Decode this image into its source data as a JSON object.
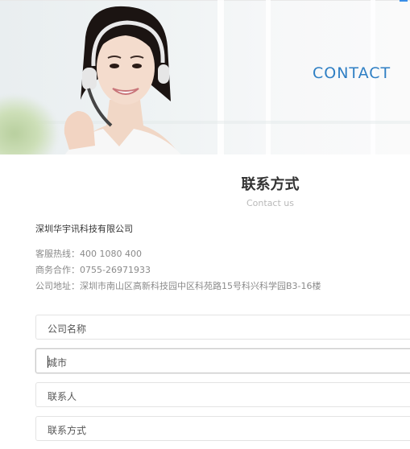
{
  "banner": {
    "title": "CONTACT"
  },
  "section": {
    "heading": "联系方式",
    "subheading": "Contact us"
  },
  "company": {
    "name": "深圳华宇讯科技有限公司",
    "hotline_label": "客服热线：",
    "hotline_value": "400 1080 400",
    "business_label": "商务合作：",
    "business_value": "0755-26971933",
    "address_label": "公司地址：",
    "address_value": "深圳市南山区高新科技园中区科苑路15号科兴科学园B3-16楼"
  },
  "form": {
    "fields": [
      {
        "placeholder": "公司名称"
      },
      {
        "placeholder": "城市"
      },
      {
        "placeholder": "联系人"
      },
      {
        "placeholder": "联系方式"
      }
    ]
  },
  "colors": {
    "accent": "#2f7fc4",
    "heading": "#333333",
    "muted": "#8a8a8a"
  },
  "icons": [
    "headset-icon"
  ]
}
